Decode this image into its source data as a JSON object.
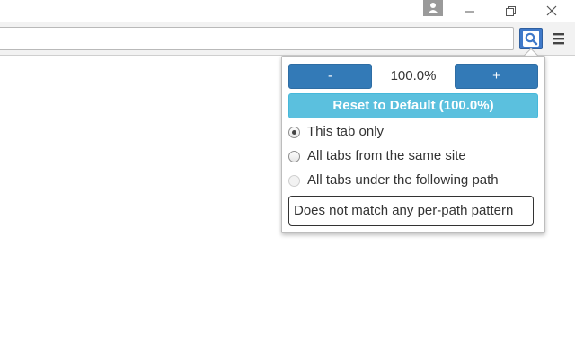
{
  "window": {
    "controls": {
      "profile_icon": "person-icon",
      "minimize_icon": "minimize-icon",
      "restore_icon": "restore-icon",
      "close_icon": "close-icon"
    }
  },
  "toolbar": {
    "omnibox_value": "",
    "extension_icon": "magnifier-icon",
    "menu_icon": "hamburger-menu-icon"
  },
  "popup": {
    "decrease_label": "-",
    "zoom_level": "100.0%",
    "increase_label": "+",
    "reset_label": "Reset to Default (100.0%)",
    "scope_options": [
      {
        "label": "This tab only",
        "checked": true,
        "disabled": false
      },
      {
        "label": "All tabs from the same site",
        "checked": false,
        "disabled": false
      },
      {
        "label": "All tabs under the following path",
        "checked": false,
        "disabled": true
      }
    ],
    "path_pattern_text": "Does not match any per-path pattern"
  },
  "colors": {
    "primary_button": "#337ab7",
    "reset_button": "#5bc0de",
    "extension_button": "#3f79c9"
  }
}
